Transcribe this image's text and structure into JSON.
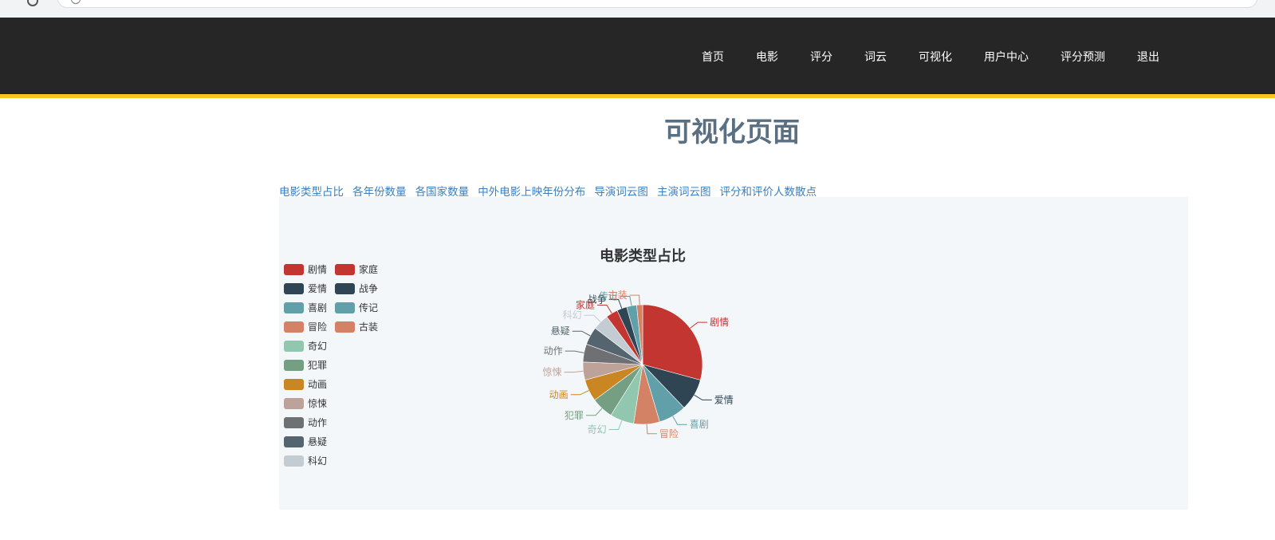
{
  "nav": {
    "items": [
      {
        "key": "home",
        "label": "首页"
      },
      {
        "key": "movies",
        "label": "电影"
      },
      {
        "key": "ratings",
        "label": "评分"
      },
      {
        "key": "wordcloud",
        "label": "词云"
      },
      {
        "key": "visualization",
        "label": "可视化"
      },
      {
        "key": "user_center",
        "label": "用户中心"
      },
      {
        "key": "rating_prediction",
        "label": "评分预测"
      },
      {
        "key": "logout",
        "label": "退出"
      }
    ]
  },
  "page": {
    "title": "可视化页面"
  },
  "tabs": [
    "电影类型占比",
    "各年份数量",
    "各国家数量",
    "中外电影上映年份分布",
    "导演词云图",
    "主演词云图",
    "评分和评价人数散点"
  ],
  "chart_data": {
    "type": "pie",
    "title": "电影类型占比",
    "legend_position": "left",
    "series": [
      {
        "name": "剧情",
        "value": 27.0,
        "color": "#c23531"
      },
      {
        "name": "爱情",
        "value": 8.0,
        "color": "#2f4554"
      },
      {
        "name": "喜剧",
        "value": 7.0,
        "color": "#61a0a8"
      },
      {
        "name": "冒险",
        "value": 6.5,
        "color": "#d48265"
      },
      {
        "name": "奇幻",
        "value": 6.0,
        "color": "#91c7ae"
      },
      {
        "name": "犯罪",
        "value": 5.5,
        "color": "#749f83"
      },
      {
        "name": "动画",
        "value": 5.5,
        "color": "#ca8622"
      },
      {
        "name": "惊悚",
        "value": 4.5,
        "color": "#bda29a"
      },
      {
        "name": "动作",
        "value": 4.5,
        "color": "#6e7074"
      },
      {
        "name": "悬疑",
        "value": 4.5,
        "color": "#546570"
      },
      {
        "name": "科幻",
        "value": 4.0,
        "color": "#c4ccd3"
      },
      {
        "name": "家庭",
        "value": 3.0,
        "color": "#c23531"
      },
      {
        "name": "战争",
        "value": 2.5,
        "color": "#2f4554"
      },
      {
        "name": "传记",
        "value": 2.5,
        "color": "#61a0a8"
      },
      {
        "name": "古装",
        "value": 1.5,
        "color": "#d48265"
      }
    ]
  }
}
